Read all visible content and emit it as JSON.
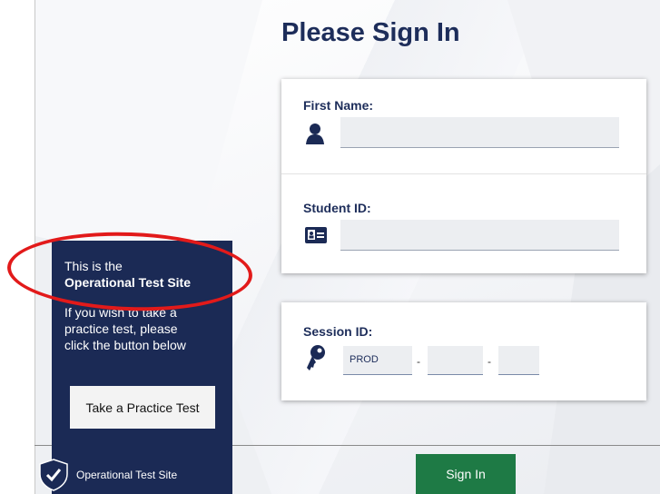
{
  "header": {
    "title": "Please Sign In"
  },
  "form": {
    "first_name_label": "First Name:",
    "first_name_value": "",
    "student_id_label": "Student ID:",
    "student_id_value": "",
    "session_label": "Session ID:",
    "session_prefix": "PROD",
    "session_part2": "",
    "session_part3": "",
    "session_dash": "-"
  },
  "side_panel": {
    "line1": "This is the",
    "line2": "Operational Test Site",
    "line3": "If you wish to take a",
    "line4": "practice test, please",
    "line5": "click the button below",
    "practice_button": "Take a Practice Test",
    "footer_label": "Operational Test Site"
  },
  "actions": {
    "sign_in": "Sign In"
  },
  "colors": {
    "navy": "#1b2a55",
    "title": "#1d2d5a",
    "sign_in_green": "#1e7a45",
    "highlight_red": "#e21a1a"
  },
  "icons": [
    "user-icon",
    "id-card-icon",
    "key-icon",
    "shield-check-icon"
  ]
}
